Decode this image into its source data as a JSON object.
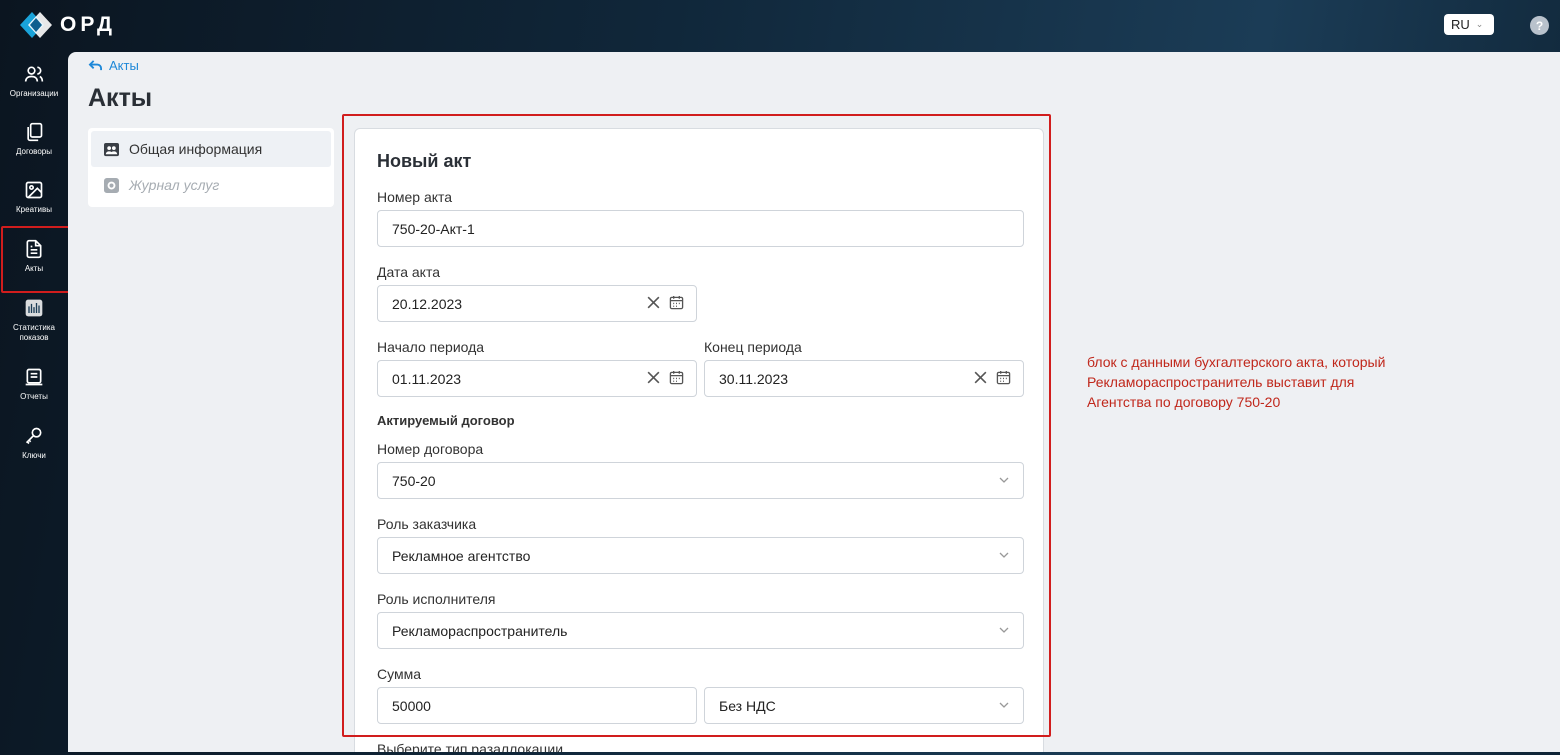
{
  "app": {
    "logo_text": "ОРД"
  },
  "header": {
    "language": "RU",
    "help": "?"
  },
  "nav": {
    "items": [
      {
        "id": "organizations",
        "label": "Организации",
        "icon": "users-icon"
      },
      {
        "id": "contracts",
        "label": "Договоры",
        "icon": "documents-icon"
      },
      {
        "id": "creatives",
        "label": "Креативы",
        "icon": "image-icon"
      },
      {
        "id": "acts",
        "label": "Акты",
        "icon": "file-text-icon",
        "active": true
      },
      {
        "id": "stats",
        "label": "Статистика показов",
        "icon": "bar-chart-icon"
      },
      {
        "id": "reports",
        "label": "Отчеты",
        "icon": "report-icon"
      },
      {
        "id": "keys",
        "label": "Ключи",
        "icon": "key-icon"
      }
    ]
  },
  "breadcrumb": {
    "back_label": "Акты"
  },
  "page": {
    "title": "Акты"
  },
  "tabs": [
    {
      "label": "Общая информация",
      "icon": "people-card-icon",
      "active": true
    },
    {
      "label": "Журнал услуг",
      "icon": "gear-icon",
      "disabled": true
    }
  ],
  "form": {
    "title": "Новый акт",
    "act_number": {
      "label": "Номер акта",
      "value": "750-20-Акт-1"
    },
    "act_date": {
      "label": "Дата акта",
      "value": "20.12.2023"
    },
    "period_start": {
      "label": "Начало периода",
      "value": "01.11.2023"
    },
    "period_end": {
      "label": "Конец периода",
      "value": "30.11.2023"
    },
    "contract_section": "Актируемый договор",
    "contract_number": {
      "label": "Номер договора",
      "value": "750-20"
    },
    "customer_role": {
      "label": "Роль заказчика",
      "value": "Рекламное агентство"
    },
    "executor_role": {
      "label": "Роль исполнителя",
      "value": "Рекламораспространитель"
    },
    "amount": {
      "label": "Сумма",
      "value": "50000",
      "vat": "Без НДС"
    },
    "allocation_label": "Выберите тип разаллокации"
  },
  "annotation": {
    "line1": "блок с данными бухгалтерского акта, который",
    "line2": "Рекламораспространитель выставит для",
    "line3": "Агентства по договору 750-20"
  },
  "colors": {
    "accent": "#1e88d8",
    "highlight": "#d11d1d",
    "annotation": "#c0271b"
  }
}
